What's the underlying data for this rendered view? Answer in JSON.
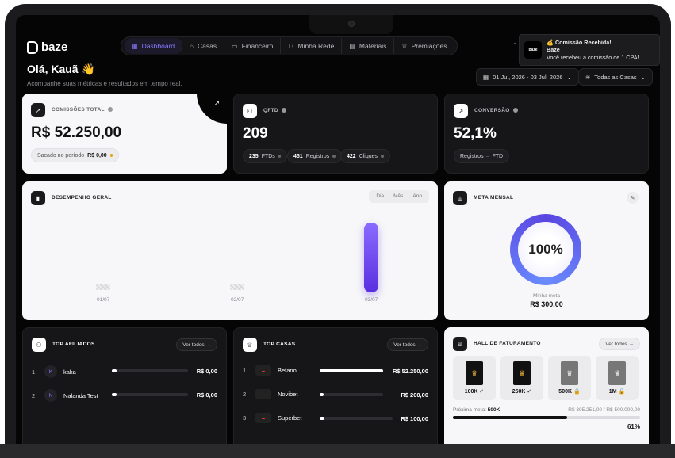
{
  "app": {
    "logo_text": "baze"
  },
  "nav": {
    "items": [
      {
        "icon": "dashboard-icon",
        "label": "Dashboard",
        "active": true
      },
      {
        "icon": "home-icon",
        "label": "Casas"
      },
      {
        "icon": "wallet-icon",
        "label": "Financeiro"
      },
      {
        "icon": "users-icon",
        "label": "Minha Rede"
      },
      {
        "icon": "file-icon",
        "label": "Materiais"
      },
      {
        "icon": "trophy-icon",
        "label": "Premiações"
      }
    ]
  },
  "toast": {
    "title": "💰 Comissão Recebida!",
    "sender": "Baze",
    "message": "Você recebeu a comissão de 1 CPA!",
    "logo_text": "baze"
  },
  "header": {
    "greeting": "Olá, Kauã 👋",
    "subtitle": "Acompanhe suas métricas e resultados em tempo real.",
    "date_range": "01 Jul, 2026 - 03 Jul, 2026",
    "house_filter": "Todas as Casas"
  },
  "kpis": {
    "commissions": {
      "title": "COMISSÕES TOTAL",
      "value": "R$ 52.250,00",
      "chip_label": "Sacado no período",
      "chip_value": "R$ 0,00"
    },
    "qftd": {
      "title": "QFTD",
      "value": "209",
      "chips": [
        {
          "value": "235",
          "label": "FTDs"
        },
        {
          "value": "451",
          "label": "Registros"
        },
        {
          "value": "422",
          "label": "Cliques"
        }
      ]
    },
    "conversion": {
      "title": "CONVERSÃO",
      "value": "52,1%",
      "chip_label": "Registros → FTD"
    }
  },
  "performance": {
    "title": "DESEMPENHO GERAL",
    "ranges": [
      "Dia",
      "Mês",
      "Ano"
    ]
  },
  "chart_data": {
    "type": "bar",
    "title": "DESEMPENHO GERAL",
    "categories": [
      "01/07",
      "02/07",
      "03/07"
    ],
    "values": [
      0,
      0,
      52250
    ],
    "xlabel": "",
    "ylabel": "",
    "grid": false
  },
  "goal": {
    "title": "META MENSAL",
    "percent": "100%",
    "percent_value": 1.0,
    "label": "Minha meta",
    "value": "R$ 300,00"
  },
  "top_affiliates": {
    "title": "TOP AFILIADOS",
    "link": "Ver todos →",
    "rows": [
      {
        "rank": "1",
        "initial": "K",
        "name": "kaka",
        "amount": "R$ 0,00",
        "share": 0.02
      },
      {
        "rank": "2",
        "initial": "N",
        "name": "Nalanda Test",
        "amount": "R$ 0,00",
        "share": 0.02
      }
    ]
  },
  "top_houses": {
    "title": "TOP CASAS",
    "link": "Ver todos →",
    "rows": [
      {
        "rank": "1",
        "name": "Betano",
        "amount": "R$ 52.250,00",
        "share": 1.0
      },
      {
        "rank": "2",
        "name": "Novibet",
        "amount": "R$ 200,00",
        "share": 0.04
      },
      {
        "rank": "3",
        "name": "Superbet",
        "amount": "R$ 100,00",
        "share": 0.04
      }
    ]
  },
  "hall": {
    "title": "HALL DE FATURAMENTO",
    "link": "Ver todos →",
    "tiers": [
      {
        "label": "100K ✓",
        "locked": false
      },
      {
        "label": "250K ✓",
        "locked": false
      },
      {
        "label": "500K 🔒",
        "locked": true
      },
      {
        "label": "1M 🔒",
        "locked": true
      }
    ],
    "next_goal_label": "Próxima meta:",
    "next_goal_value": "500K",
    "progress_text": "R$ 305.251,00 / R$ 500.000,00",
    "progress_percent": "61%",
    "progress_fraction": 0.61
  },
  "colors": {
    "accent": "#7b61ff",
    "background": "#050505",
    "card_dark": "#161618",
    "card_light": "#f7f7f9"
  }
}
